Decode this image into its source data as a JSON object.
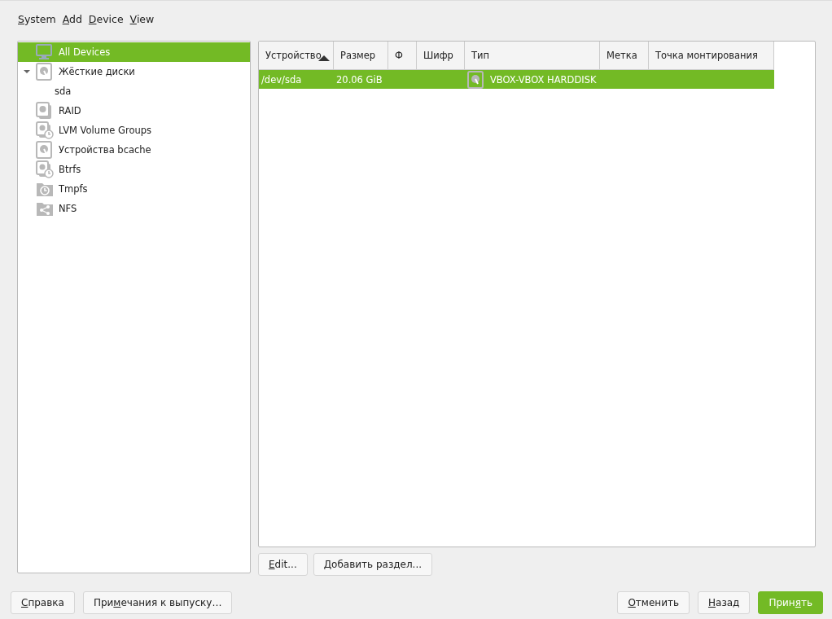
{
  "menu": [
    {
      "key": "S",
      "post": "ystem"
    },
    {
      "key": "A",
      "post": "dd"
    },
    {
      "key": "D",
      "post": "evice"
    },
    {
      "key": "V",
      "post": "iew"
    }
  ],
  "tree": [
    {
      "label": "All Devices",
      "kind": "monitor",
      "selected": true
    },
    {
      "label": "Жёсткие диски",
      "kind": "disk",
      "selected": false,
      "expanded": true,
      "children": [
        {
          "label": "sda",
          "selected": false
        }
      ]
    },
    {
      "label": "RAID",
      "kind": "raid",
      "selected": false
    },
    {
      "label": "LVM Volume Groups",
      "kind": "lvm",
      "selected": false
    },
    {
      "label": "Устройства bcache",
      "kind": "disk",
      "selected": false
    },
    {
      "label": "Btrfs",
      "kind": "lvm",
      "selected": false
    },
    {
      "label": "Tmpfs",
      "kind": "tmpfs",
      "selected": false
    },
    {
      "label": "NFS",
      "kind": "nfs",
      "selected": false
    }
  ],
  "table": {
    "columns": [
      {
        "label": "Устройство",
        "sorted": true
      },
      {
        "label": "Размер",
        "sorted": false
      },
      {
        "label": "Ф",
        "sorted": false
      },
      {
        "label": "Шифр",
        "sorted": false
      },
      {
        "label": "Тип",
        "sorted": false
      },
      {
        "label": "Метка",
        "sorted": false
      },
      {
        "label": "Точка монтирования",
        "sorted": false
      }
    ],
    "rows": [
      {
        "selected": true,
        "cells": [
          "/dev/sda",
          "20.06 GiB",
          null,
          null,
          "VBOX-VBOX HARDDISK",
          null,
          null
        ]
      }
    ]
  },
  "table_buttons": [
    {
      "key": "E",
      "post": "dit..."
    },
    {
      "pre": "Добавить раздел..."
    }
  ],
  "footer_left": [
    {
      "key": "С",
      "post": "правка",
      "primary": false
    },
    {
      "pre": "При",
      "key": "м",
      "post": "ечания к выпуску…",
      "primary": false
    }
  ],
  "footer_right": [
    {
      "key": "О",
      "post": "тменить",
      "primary": false
    },
    {
      "key": "Н",
      "post": "азад",
      "primary": false
    },
    {
      "pre": "Прин",
      "key": "я",
      "post": "ть",
      "primary": true
    }
  ]
}
